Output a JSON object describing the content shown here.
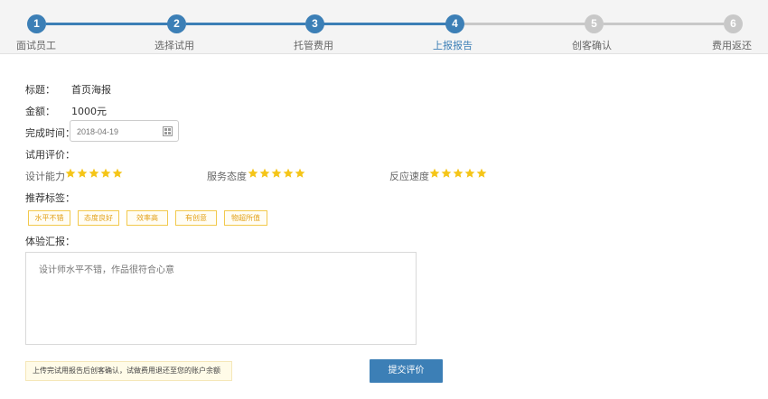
{
  "stepper": {
    "steps": [
      {
        "num": "1",
        "label": "面试员工",
        "state": "done"
      },
      {
        "num": "2",
        "label": "选择试用",
        "state": "done"
      },
      {
        "num": "3",
        "label": "托管费用",
        "state": "done"
      },
      {
        "num": "4",
        "label": "上报报告",
        "state": "active"
      },
      {
        "num": "5",
        "label": "创客确认",
        "state": "todo"
      },
      {
        "num": "6",
        "label": "费用返还",
        "state": "todo"
      }
    ]
  },
  "form": {
    "title_label": "标题：",
    "title_value": "首页海报",
    "amount_label": "金额：",
    "amount_value": "1000元",
    "finish_time_label": "完成时间：",
    "finish_time_placeholder": "2018-04-19",
    "evaluation_label": "试用评价：",
    "ratings": [
      {
        "label": "设计能力",
        "stars": 5
      },
      {
        "label": "服务态度",
        "stars": 5
      },
      {
        "label": "反应速度",
        "stars": 5
      }
    ],
    "tags_label": "推荐标签：",
    "tags": [
      "水平不错",
      "态度良好",
      "效率高",
      "有创意",
      "物超所值"
    ],
    "report_label": "体验汇报：",
    "report_placeholder": "设计师水平不错，作品很符合心意",
    "notice": "上传完试用报告后创客确认，试做费用退还至您的账户余额",
    "submit_label": "提交评价"
  },
  "colors": {
    "primary": "#3c7fb6",
    "inactive": "#c8c8c8",
    "star": "#f5c518",
    "tag_border": "#f2c94c"
  }
}
